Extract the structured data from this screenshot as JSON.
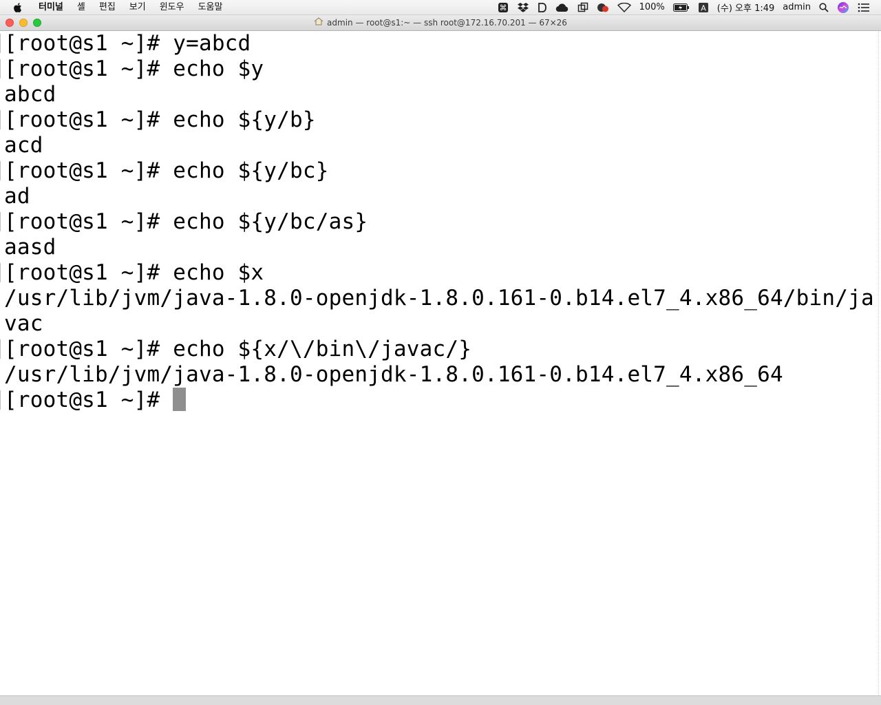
{
  "menubar": {
    "app_name": "터미널",
    "items": [
      "셸",
      "편집",
      "보기",
      "윈도우",
      "도움말"
    ],
    "battery_text": "100%",
    "input_source": "A",
    "clock": "(수) 오후 1:49",
    "user": "admin"
  },
  "window": {
    "title": "admin — root@s1:~ — ssh root@172.16.70.201 — 67×26"
  },
  "terminal": {
    "lines": [
      "[root@s1 ~]# y=abcd",
      "[root@s1 ~]# echo $y",
      "abcd",
      "[root@s1 ~]# echo ${y/b}",
      "acd",
      "[root@s1 ~]# echo ${y/bc}",
      "ad",
      "[root@s1 ~]# echo ${y/bc/as}",
      "aasd",
      "[root@s1 ~]# echo $x",
      "/usr/lib/jvm/java-1.8.0-openjdk-1.8.0.161-0.b14.el7_4.x86_64/bin/ja",
      "vac",
      "[root@s1 ~]# echo ${x/\\/bin\\/javac/}",
      "/usr/lib/jvm/java-1.8.0-openjdk-1.8.0.161-0.b14.el7_4.x86_64"
    ],
    "prompt": "[root@s1 ~]# "
  }
}
